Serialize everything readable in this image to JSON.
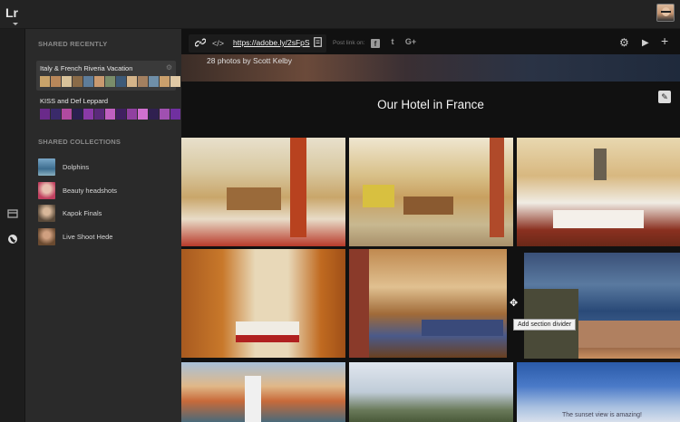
{
  "app": {
    "logo": "Lr"
  },
  "panel": {
    "shared_recently_heading": "SHARED RECENTLY",
    "shared_collections_heading": "SHARED COLLECTIONS",
    "albums": [
      {
        "name": "Italy & French Riveria Vacation",
        "selected": true
      },
      {
        "name": "KISS and Def Leppard",
        "selected": false
      }
    ],
    "collections": [
      {
        "label": "Dolphins"
      },
      {
        "label": "Beauty headshots"
      },
      {
        "label": "Kapok Finals"
      },
      {
        "label": "Live Shoot Hede"
      }
    ]
  },
  "toolbar": {
    "link_url": "https://adobe.ly/2sFpS",
    "post_link_label": "Post link on:",
    "social": [
      "f",
      "t",
      "G+"
    ]
  },
  "main": {
    "banner_text": "28 photos by Scott Kelby",
    "section_title": "Our Hotel in France",
    "divider_tooltip": "Add section divider",
    "caption_tail": "The sunset view is amazing!"
  },
  "colors": {
    "panel_bg": "#2a2a2a",
    "topbar_bg": "#232323",
    "main_bg": "#111111"
  }
}
